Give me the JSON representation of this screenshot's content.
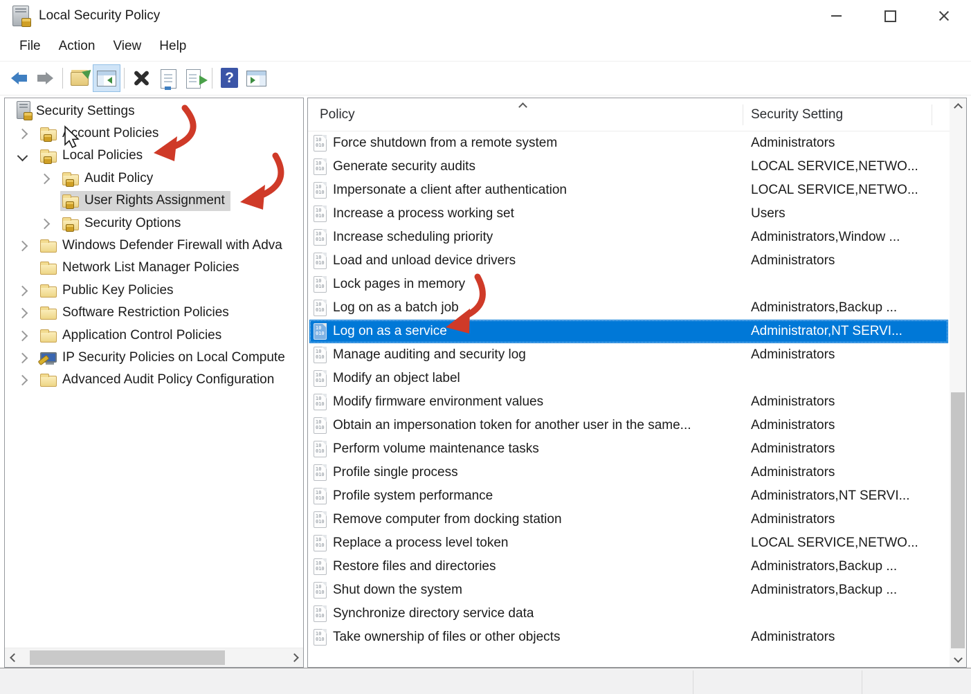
{
  "window": {
    "title": "Local Security Policy",
    "controls": [
      "minimize",
      "maximize",
      "close"
    ]
  },
  "menu": {
    "items": [
      "File",
      "Action",
      "View",
      "Help"
    ]
  },
  "toolbar": {
    "items": [
      {
        "icon": "back-icon"
      },
      {
        "icon": "forward-icon"
      },
      {
        "sep": true
      },
      {
        "icon": "folder-arrow-icon"
      },
      {
        "icon": "console-tree-icon",
        "active": true
      },
      {
        "sep": true
      },
      {
        "icon": "delete-icon"
      },
      {
        "icon": "properties-icon"
      },
      {
        "icon": "export-list-icon"
      },
      {
        "sep": true
      },
      {
        "icon": "help-icon"
      },
      {
        "icon": "action-pane-icon"
      }
    ]
  },
  "tree": {
    "items": [
      {
        "label": "Security Settings",
        "icon": "security-root-icon",
        "indent": 0,
        "expander": "root"
      },
      {
        "label": "Account Policies",
        "icon": "folder-lock-icon",
        "indent": 1,
        "expander": "collapsed"
      },
      {
        "label": "Local Policies",
        "icon": "folder-lock-icon",
        "indent": 1,
        "expander": "expanded"
      },
      {
        "label": "Audit Policy",
        "icon": "folder-lock-icon",
        "indent": 2,
        "expander": "collapsed"
      },
      {
        "label": "User Rights Assignment",
        "icon": "folder-lock-icon",
        "indent": 2,
        "expander": "none",
        "selected": true
      },
      {
        "label": "Security Options",
        "icon": "folder-lock-icon",
        "indent": 2,
        "expander": "collapsed"
      },
      {
        "label": "Windows Defender Firewall with Adva",
        "icon": "folder-icon",
        "indent": 1,
        "expander": "collapsed"
      },
      {
        "label": "Network List Manager Policies",
        "icon": "folder-icon",
        "indent": 1,
        "expander": "none"
      },
      {
        "label": "Public Key Policies",
        "icon": "folder-icon",
        "indent": 1,
        "expander": "collapsed"
      },
      {
        "label": "Software Restriction Policies",
        "icon": "folder-icon",
        "indent": 1,
        "expander": "collapsed"
      },
      {
        "label": "Application Control Policies",
        "icon": "folder-icon",
        "indent": 1,
        "expander": "collapsed"
      },
      {
        "label": "IP Security Policies on Local Compute",
        "icon": "ipsec-icon",
        "indent": 1,
        "expander": "collapsed"
      },
      {
        "label": "Advanced Audit Policy Configuration",
        "icon": "folder-icon",
        "indent": 1,
        "expander": "collapsed"
      }
    ]
  },
  "list": {
    "columns": [
      "Policy",
      "Security Setting"
    ],
    "sort": "ascending",
    "rows": [
      {
        "policy": "Force shutdown from a remote system",
        "setting": "Administrators"
      },
      {
        "policy": "Generate security audits",
        "setting": "LOCAL SERVICE,NETWO..."
      },
      {
        "policy": "Impersonate a client after authentication",
        "setting": "LOCAL SERVICE,NETWO..."
      },
      {
        "policy": "Increase a process working set",
        "setting": "Users"
      },
      {
        "policy": "Increase scheduling priority",
        "setting": "Administrators,Window ..."
      },
      {
        "policy": "Load and unload device drivers",
        "setting": "Administrators"
      },
      {
        "policy": "Lock pages in memory",
        "setting": ""
      },
      {
        "policy": "Log on as a batch job",
        "setting": "Administrators,Backup ..."
      },
      {
        "policy": "Log on as a service",
        "setting": "Administrator,NT SERVI...",
        "selected": true
      },
      {
        "policy": "Manage auditing and security log",
        "setting": "Administrators"
      },
      {
        "policy": "Modify an object label",
        "setting": ""
      },
      {
        "policy": "Modify firmware environment values",
        "setting": "Administrators"
      },
      {
        "policy": "Obtain an impersonation token for another user in the same...",
        "setting": "Administrators"
      },
      {
        "policy": "Perform volume maintenance tasks",
        "setting": "Administrators"
      },
      {
        "policy": "Profile single process",
        "setting": "Administrators"
      },
      {
        "policy": "Profile system performance",
        "setting": "Administrators,NT SERVI..."
      },
      {
        "policy": "Remove computer from docking station",
        "setting": "Administrators"
      },
      {
        "policy": "Replace a process level token",
        "setting": "LOCAL SERVICE,NETWO..."
      },
      {
        "policy": "Restore files and directories",
        "setting": "Administrators,Backup ..."
      },
      {
        "policy": "Shut down the system",
        "setting": "Administrators,Backup ..."
      },
      {
        "policy": "Synchronize directory service data",
        "setting": ""
      },
      {
        "policy": "Take ownership of files or other objects",
        "setting": "Administrators"
      }
    ]
  },
  "annotations": {
    "arrows": [
      {
        "target": "Local Policies"
      },
      {
        "target": "User Rights Assignment"
      },
      {
        "target": "Log on as a service"
      }
    ],
    "cursor_near": "Account Policies"
  },
  "colors": {
    "selection": "#0078d7",
    "tree_selection": "#d6d6d6",
    "annotation_arrow": "#cf3a28"
  }
}
